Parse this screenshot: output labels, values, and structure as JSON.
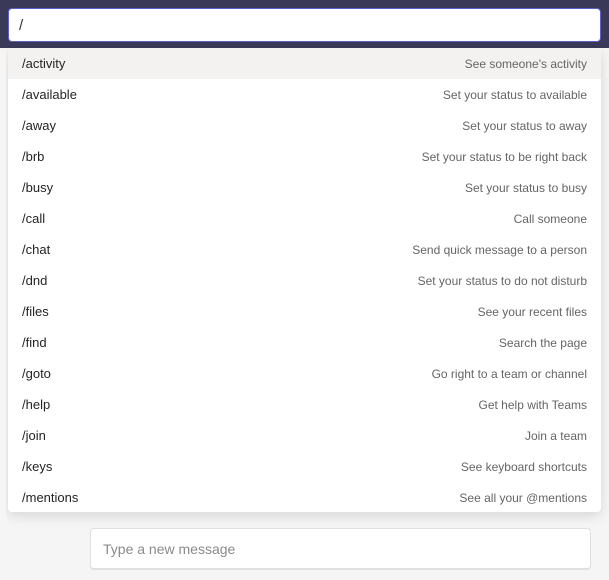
{
  "search": {
    "value": "/"
  },
  "compose": {
    "placeholder": "Type a new message"
  },
  "commands": [
    {
      "cmd": "/activity",
      "desc": "See someone's activity",
      "highlighted": true
    },
    {
      "cmd": "/available",
      "desc": "Set your status to available",
      "highlighted": false
    },
    {
      "cmd": "/away",
      "desc": "Set your status to away",
      "highlighted": false
    },
    {
      "cmd": "/brb",
      "desc": "Set your status to be right back",
      "highlighted": false
    },
    {
      "cmd": "/busy",
      "desc": "Set your status to busy",
      "highlighted": false
    },
    {
      "cmd": "/call",
      "desc": "Call someone",
      "highlighted": false
    },
    {
      "cmd": "/chat",
      "desc": "Send quick message to a person",
      "highlighted": false
    },
    {
      "cmd": "/dnd",
      "desc": "Set your status to do not disturb",
      "highlighted": false
    },
    {
      "cmd": "/files",
      "desc": "See your recent files",
      "highlighted": false
    },
    {
      "cmd": "/find",
      "desc": "Search the page",
      "highlighted": false
    },
    {
      "cmd": "/goto",
      "desc": "Go right to a team or channel",
      "highlighted": false
    },
    {
      "cmd": "/help",
      "desc": "Get help with Teams",
      "highlighted": false
    },
    {
      "cmd": "/join",
      "desc": "Join a team",
      "highlighted": false
    },
    {
      "cmd": "/keys",
      "desc": "See keyboard shortcuts",
      "highlighted": false
    },
    {
      "cmd": "/mentions",
      "desc": "See all your @mentions",
      "highlighted": false
    }
  ]
}
